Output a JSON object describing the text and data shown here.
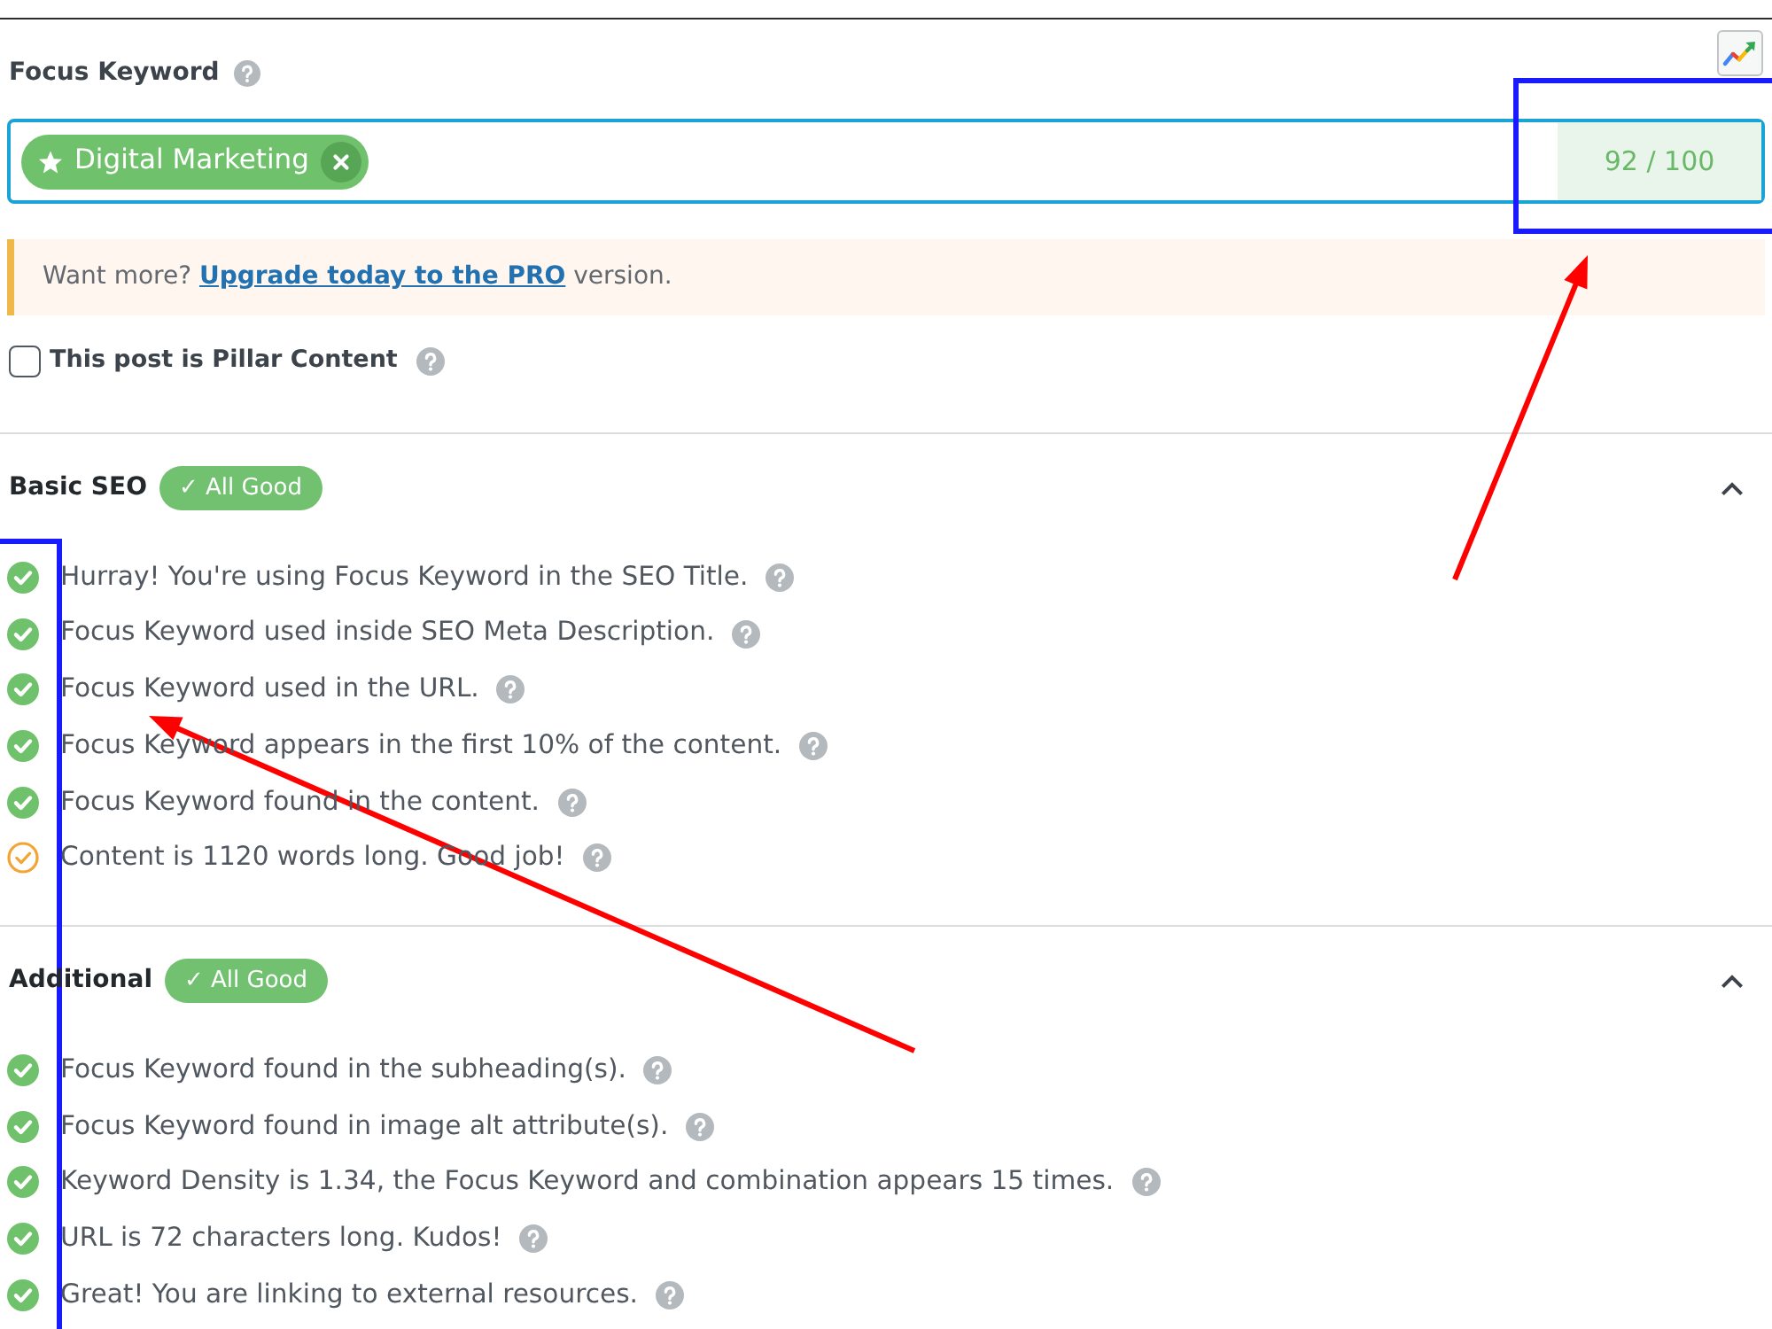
{
  "focus_keyword": {
    "label": "Focus Keyword",
    "keywords": [
      {
        "text": "Digital Marketing"
      }
    ],
    "score": "92 / 100"
  },
  "notice": {
    "before": "Want more?",
    "link": "Upgrade today to the PRO",
    "after": "version."
  },
  "pillar": {
    "label": "This post is Pillar Content",
    "checked": false
  },
  "sections": [
    {
      "title": "Basic SEO",
      "badge": "✓ All Good",
      "expanded": true,
      "items": [
        {
          "text": "Hurray! You're using Focus Keyword in the SEO Title.",
          "kind": "pass"
        },
        {
          "text": "Focus Keyword used inside SEO Meta Description.",
          "kind": "pass"
        },
        {
          "text": "Focus Keyword used in the URL.",
          "kind": "pass"
        },
        {
          "text": "Focus Keyword appears in the first 10% of the content.",
          "kind": "pass"
        },
        {
          "text": "Focus Keyword found in the content.",
          "kind": "pass"
        },
        {
          "text": "Content is 1120 words long. Good job!",
          "kind": "warning"
        }
      ]
    },
    {
      "title": "Additional",
      "badge": "✓ All Good",
      "expanded": true,
      "items": [
        {
          "text": "Focus Keyword found in the subheading(s).",
          "kind": "pass"
        },
        {
          "text": "Focus Keyword found in image alt attribute(s).",
          "kind": "pass"
        },
        {
          "text": "Keyword Density is 1.34, the Focus Keyword and combination appears 15 times.",
          "kind": "pass"
        },
        {
          "text": "URL is 72 characters long. Kudos!",
          "kind": "pass"
        },
        {
          "text": "Great! You are linking to external resources.",
          "kind": "pass"
        }
      ]
    }
  ],
  "annotations": [
    {
      "kind": "frame",
      "color": "#1a1aff"
    },
    {
      "kind": "frame",
      "color": "#1a1aff"
    },
    {
      "kind": "arrow",
      "color": "#ff0000"
    },
    {
      "kind": "arrow",
      "color": "#ff0000"
    }
  ]
}
